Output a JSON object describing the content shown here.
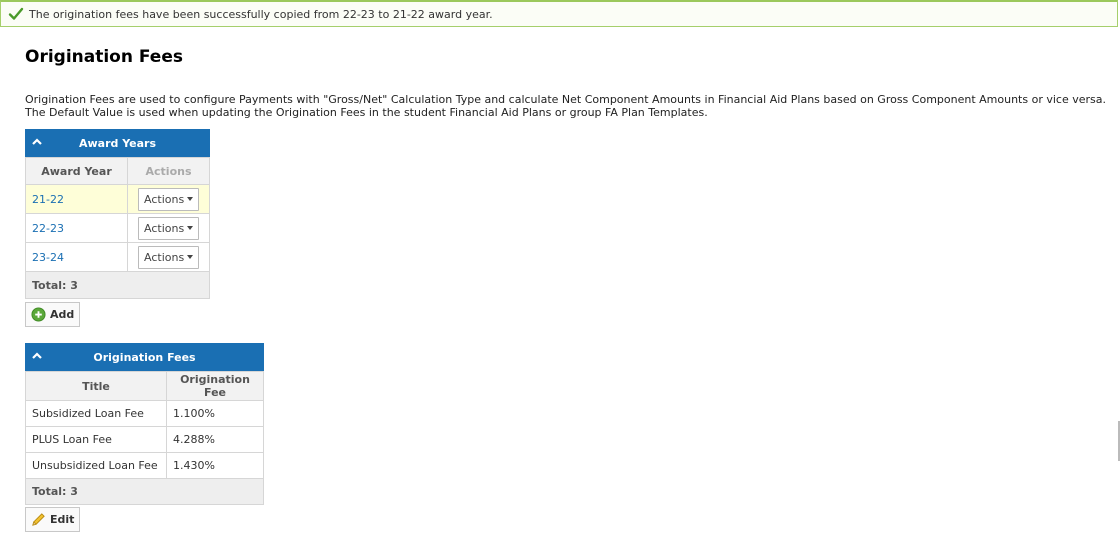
{
  "alert": {
    "message": "The origination fees have been successfully copied from 22-23 to 21-22 award year.",
    "icon": "checkmark-icon"
  },
  "page": {
    "title": "Origination Fees",
    "description_line1": "Origination Fees are used to configure Payments with \"Gross/Net\" Calculation Type and calculate Net Component Amounts in Financial Aid Plans based on Gross Component Amounts or vice versa.",
    "description_line2": "The Default Value is used when updating the Origination Fees in the student Financial Aid Plans or group FA Plan Templates."
  },
  "award_years": {
    "header": "Award Years",
    "columns": [
      "Award Year",
      "Actions"
    ],
    "rows": [
      {
        "year": "21-22",
        "action": "Actions"
      },
      {
        "year": "22-23",
        "action": "Actions"
      },
      {
        "year": "23-24",
        "action": "Actions"
      }
    ],
    "total": "Total: 3",
    "add_label": "Add"
  },
  "origination_fees": {
    "header": "Origination Fees",
    "columns": [
      "Title",
      "Origination Fee"
    ],
    "rows": [
      {
        "title": "Subsidized Loan Fee",
        "fee": "1.100%"
      },
      {
        "title": "PLUS Loan Fee",
        "fee": "4.288%"
      },
      {
        "title": "Unsubsidized Loan Fee",
        "fee": "1.430%"
      }
    ],
    "total": "Total: 3",
    "edit_label": "Edit"
  },
  "colors": {
    "header_blue": "#1a6fb3",
    "success_border": "#9bc85c",
    "highlight_row": "#fefed8"
  }
}
